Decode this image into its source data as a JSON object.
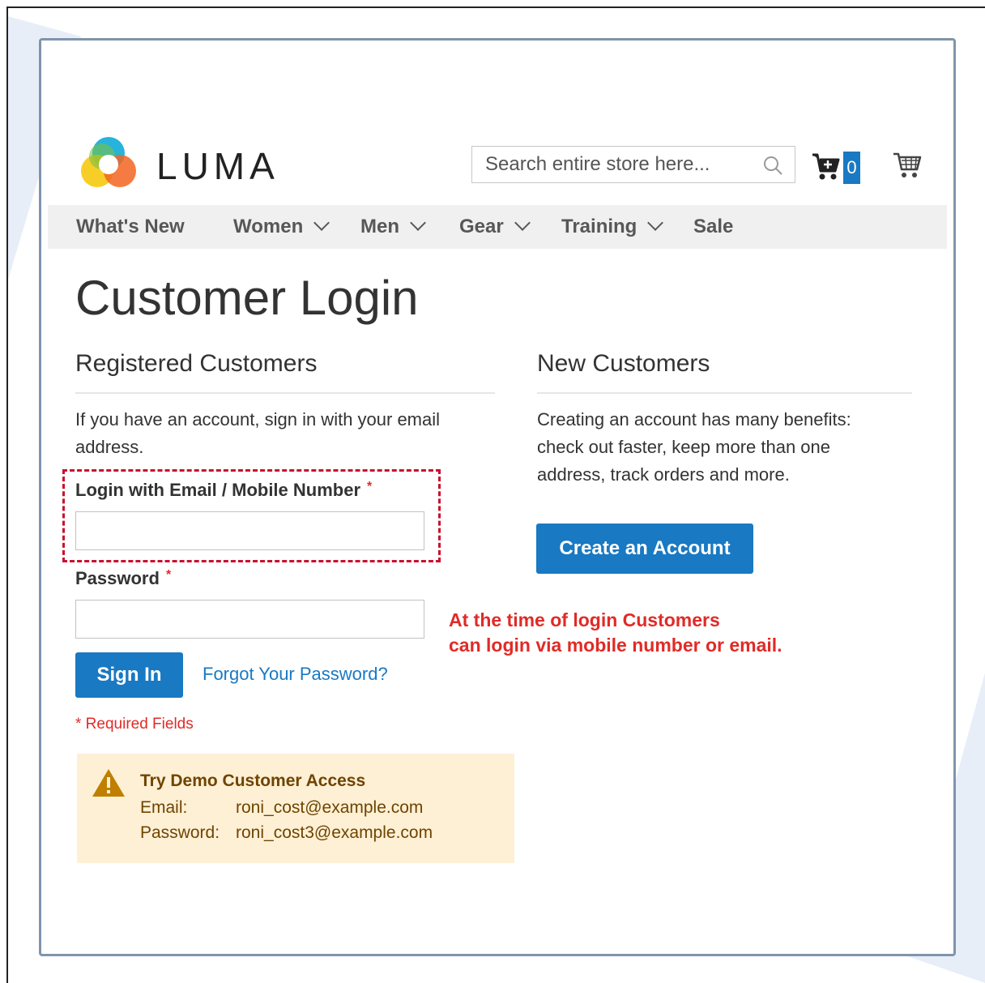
{
  "header": {
    "brand": "LUMA",
    "search_placeholder": "Search entire store here...",
    "cart_count": "0"
  },
  "nav": {
    "items": [
      {
        "label": "What's New"
      },
      {
        "label": "Women"
      },
      {
        "label": "Men"
      },
      {
        "label": "Gear"
      },
      {
        "label": "Training"
      },
      {
        "label": "Sale"
      }
    ]
  },
  "page": {
    "title": "Customer Login"
  },
  "registered": {
    "title": "Registered Customers",
    "intro_line1": "If you have an account, sign in with your email",
    "intro_line2": "address.",
    "login_label": "Login with Email / Mobile Number",
    "password_label": "Password",
    "required_mark": "*",
    "login_value": "",
    "password_value": "",
    "sign_in_label": "Sign In",
    "forgot_label": "Forgot Your Password?",
    "required_note": "* Required Fields"
  },
  "new_customers": {
    "title": "New Customers",
    "line1": "Creating an account has many benefits:",
    "line2": "check out faster, keep more than one",
    "line3": "address, track orders and more.",
    "create_label": "Create an Account"
  },
  "annotation": {
    "line1": "At the time of login Customers",
    "line2": "can login via mobile number or email."
  },
  "demo": {
    "title": "Try Demo Customer Access",
    "email_key": "Email:",
    "email_value": "roni_cost@example.com",
    "password_key": "Password:",
    "password_value": "roni_cost3@example.com"
  },
  "colors": {
    "primary": "#1979c3",
    "required": "#e02b27",
    "annotation": "#e02b27",
    "demo_bg": "#fdf0d5",
    "frame_border": "#7f95ab"
  }
}
